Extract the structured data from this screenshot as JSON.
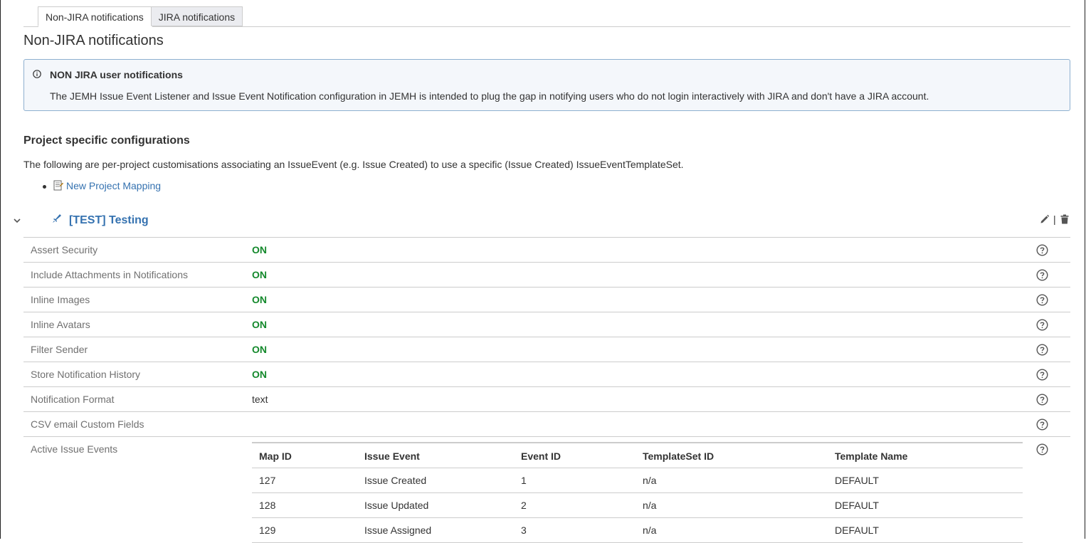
{
  "tabs": [
    {
      "label": "Non-JIRA notifications",
      "active": true
    },
    {
      "label": "JIRA notifications",
      "active": false
    }
  ],
  "page_title": "Non-JIRA notifications",
  "info": {
    "title": "NON JIRA user notifications",
    "body": "The JEMH Issue Event Listener and Issue Event Notification configuration in JEMH is intended to plug the gap in notifying users who do not login interactively with JIRA and don't have a JIRA account.",
    "icon": "info-icon"
  },
  "section": {
    "title": "Project specific configurations",
    "description": "The following are per-project customisations associating an IssueEvent (e.g. Issue Created) to use a specific (Issue Created) IssueEventTemplateSet.",
    "new_mapping_label": "New Project Mapping"
  },
  "project": {
    "title": "[TEST] Testing",
    "separator": "|",
    "properties": [
      {
        "label": "Assert Security",
        "value": "ON"
      },
      {
        "label": "Include Attachments in Notifications",
        "value": "ON"
      },
      {
        "label": "Inline Images",
        "value": "ON"
      },
      {
        "label": "Inline Avatars",
        "value": "ON"
      },
      {
        "label": "Filter Sender",
        "value": "ON"
      },
      {
        "label": "Store Notification History",
        "value": "ON"
      },
      {
        "label": "Notification Format",
        "value": "text"
      },
      {
        "label": "CSV email Custom Fields",
        "value": ""
      }
    ],
    "active_events_label": "Active Issue Events",
    "events_table": {
      "headers": [
        "Map ID",
        "Issue Event",
        "Event ID",
        "TemplateSet ID",
        "Template Name"
      ],
      "rows": [
        [
          "127",
          "Issue Created",
          "1",
          "n/a",
          "DEFAULT"
        ],
        [
          "128",
          "Issue Updated",
          "2",
          "n/a",
          "DEFAULT"
        ],
        [
          "129",
          "Issue Assigned",
          "3",
          "n/a",
          "DEFAULT"
        ]
      ]
    }
  },
  "colors": {
    "link": "#3572b0",
    "on_status": "#14892c",
    "info_border": "#8eb0d0"
  }
}
